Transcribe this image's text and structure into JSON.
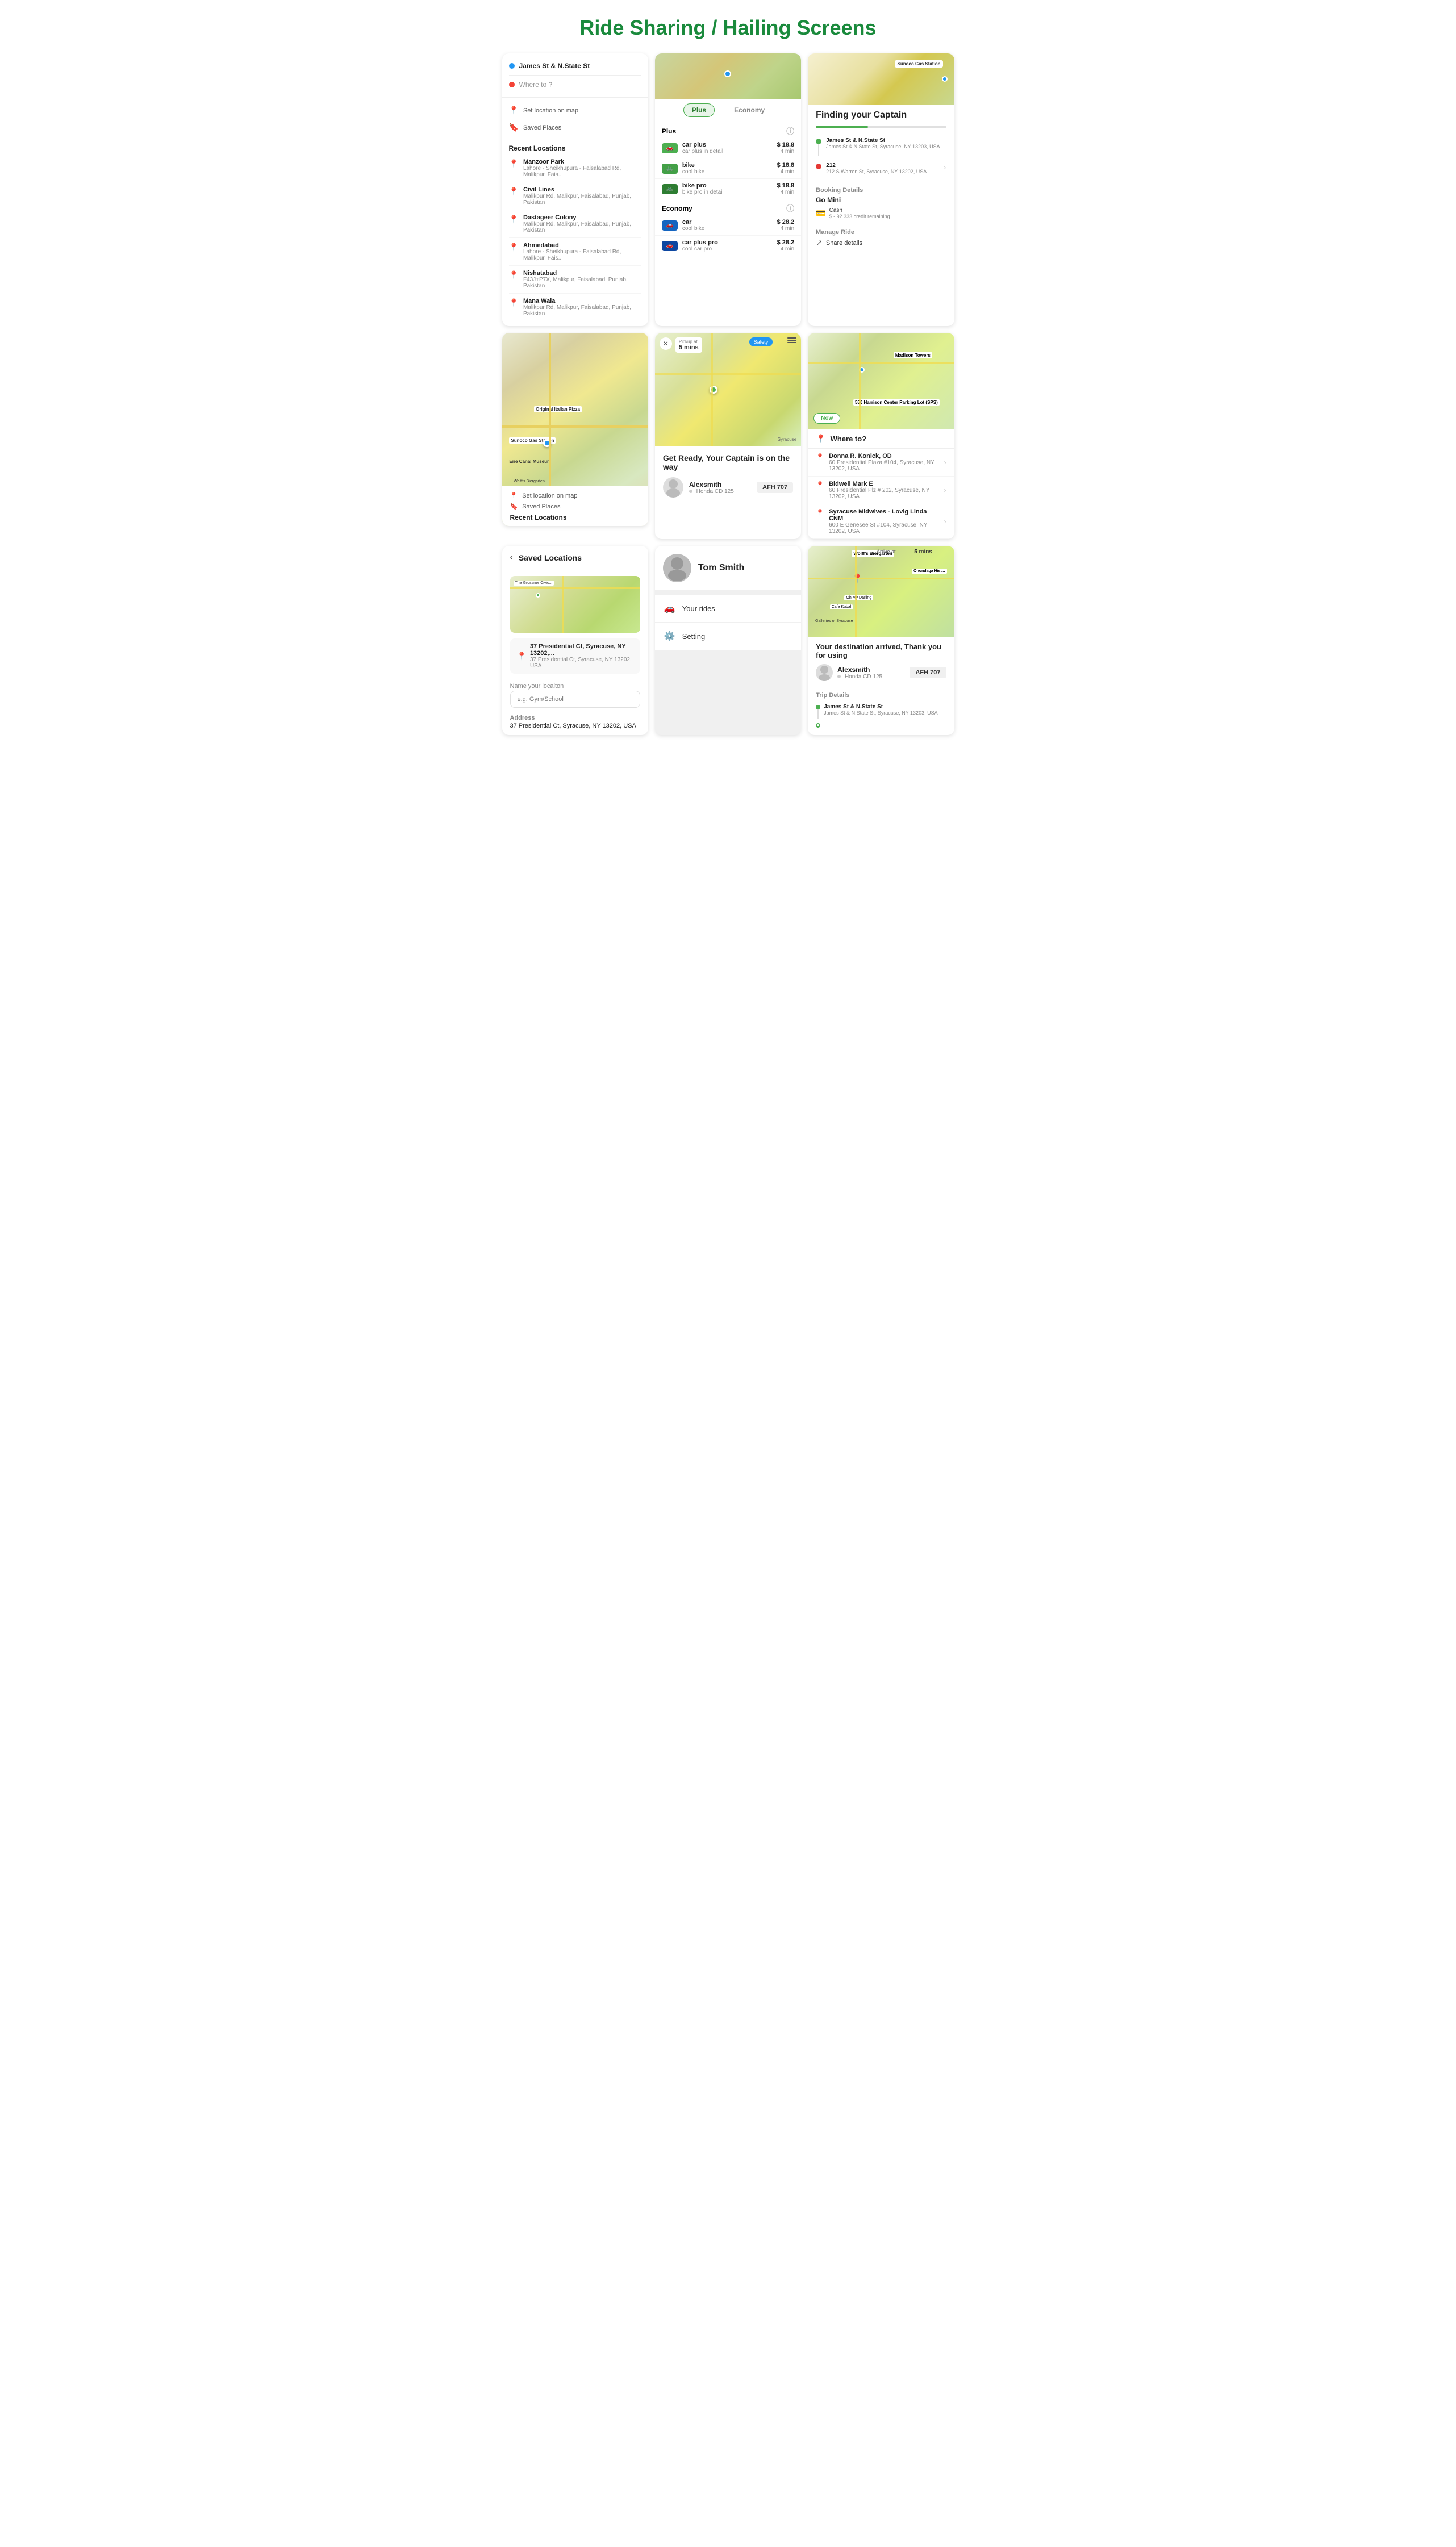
{
  "page": {
    "title": "Ride Sharing / Hailing Screens"
  },
  "screen1": {
    "origin": "James St & N.State St",
    "destination_placeholder": "Where to ?",
    "set_location": "Set location on map",
    "saved_places": "Saved Places",
    "recent_title": "Recent Locations",
    "recent_items": [
      {
        "name": "Manzoor Park",
        "addr": "Lahore - Sheikhupura - Faisalabad Rd, Malikpur, Fais..."
      },
      {
        "name": "Civil Lines",
        "addr": "Malikpur Rd, Malikpur, Faisalabad, Punjab, Pakistan"
      },
      {
        "name": "Dastageer Colony",
        "addr": "Malikpur Rd, Malikpur, Faisalabad, Punjab, Pakistan"
      },
      {
        "name": "Ahmedabad",
        "addr": "Lahore - Sheikhupura - Faisalabad Rd, Malikpur, Fais..."
      },
      {
        "name": "Nishatabad",
        "addr": "F43J+P7X, Malikpur, Faisalabad, Punjab, Pakistan"
      },
      {
        "name": "Mana Wala",
        "addr": "Malikpur Rd, Malikpur, Faisalabad, Punjab, Pakistan"
      }
    ]
  },
  "screen2": {
    "tab_plus": "Plus",
    "tab_economy": "Economy",
    "section_plus": "Plus",
    "section_economy": "Economy",
    "rides_plus": [
      {
        "name": "car plus",
        "detail": "car plus in detail",
        "price": "$ 18.8",
        "time": "4 min"
      },
      {
        "name": "bike",
        "detail": "cool bike",
        "price": "$ 18.8",
        "time": "4 min"
      },
      {
        "name": "bike pro",
        "detail": "bike pro in detail",
        "price": "$ 18.8",
        "time": "4 min"
      }
    ],
    "rides_economy": [
      {
        "name": "car",
        "detail": "cool bike",
        "price": "$ 28.2",
        "time": "4 min"
      },
      {
        "name": "car plus pro",
        "detail": "cool car pro",
        "price": "$ 28.2",
        "time": "4 min"
      }
    ]
  },
  "screen3": {
    "title": "Finding your Captain",
    "origin": "James St & N.State St",
    "origin_sub": "James St & N.State St, Syracuse, NY 13203, USA",
    "dest_number": "212",
    "dest": "212 S Warren St, Syracuse, NY 13202, USA",
    "booking_label": "Booking Details",
    "ride_type": "Go Mini",
    "payment_method": "Cash",
    "credit": "$ - 92.333 credit remaining",
    "manage_label": "Manage Ride",
    "share_label": "Share details"
  },
  "screen4": {
    "map_labels": [
      "Original Italian Pizza",
      "Sunoco Gas Station",
      "Erie Canal Museum",
      "Wolff's Biergarten"
    ],
    "bottom": {
      "set_location": "Set location on map",
      "saved_places": "Saved Places",
      "recent_title": "Recent Locations"
    }
  },
  "screen5": {
    "safety_label": "Safety",
    "pickup_label": "Pickup at",
    "pickup_time": "5 mins",
    "title": "Get Ready, Your Captain is on the way",
    "driver_name": "Alexsmith",
    "car_model": "Honda CD 125",
    "plate": "AFH 707",
    "map_label": "Syracuse"
  },
  "screen6": {
    "now_btn": "Now",
    "where_to": "Where to?",
    "map_labels": [
      "Madison Towers",
      "550 Harrison Center Parking Lot (SPS)"
    ],
    "suggestions": [
      {
        "name": "Donna R. Konick, OD",
        "addr": "60 Presidential Plaza #104, Syracuse, NY 13202, USA"
      },
      {
        "name": "Bidwell Mark E",
        "addr": "60 Presidential Plz # 202, Syracuse, NY 13202, USA"
      },
      {
        "name": "Syracuse Midwives - Lovig Linda CNM",
        "addr": "600 E Genesee St #104, Syracuse, NY 13202, USA"
      }
    ]
  },
  "screen7": {
    "title": "Saved Locations",
    "selected_addr": "37 Presidential Ct, Syracuse, NY 13202,...",
    "selected_addr_sub": "37 Presidential Ct, Syracuse, NY 13202, USA",
    "name_label": "Name your locaiton",
    "name_placeholder": "e.g. Gym/School",
    "address_label": "Address",
    "address_val": "37 Presidential Ct, Syracuse, NY 13202, USA"
  },
  "screen8": {
    "driver_name": "Tom Smith",
    "menu_items": [
      {
        "label": "Your rides",
        "icon": "🚗"
      },
      {
        "label": "Setting",
        "icon": "⚙️"
      }
    ]
  },
  "screen9": {
    "map_labels": [
      "Wolff's Biergarten",
      "Cafe Kubal",
      "Galleries of Syracuse",
      "Oh My Darling",
      "Onondaga Hist..."
    ],
    "arrive_label": "Arrive at",
    "time_label": "5 mins",
    "title": "Your destination arrived, Thank you for using",
    "driver_name": "Alexsmith",
    "car_model": "Honda CD 125",
    "plate": "AFH 707",
    "trip_label": "Trip Details",
    "trip_origin": "James St & N.State St",
    "trip_origin_sub": "James St & N.State St, Syracuse, NY 13203, USA",
    "trip_dest_dot": ""
  }
}
